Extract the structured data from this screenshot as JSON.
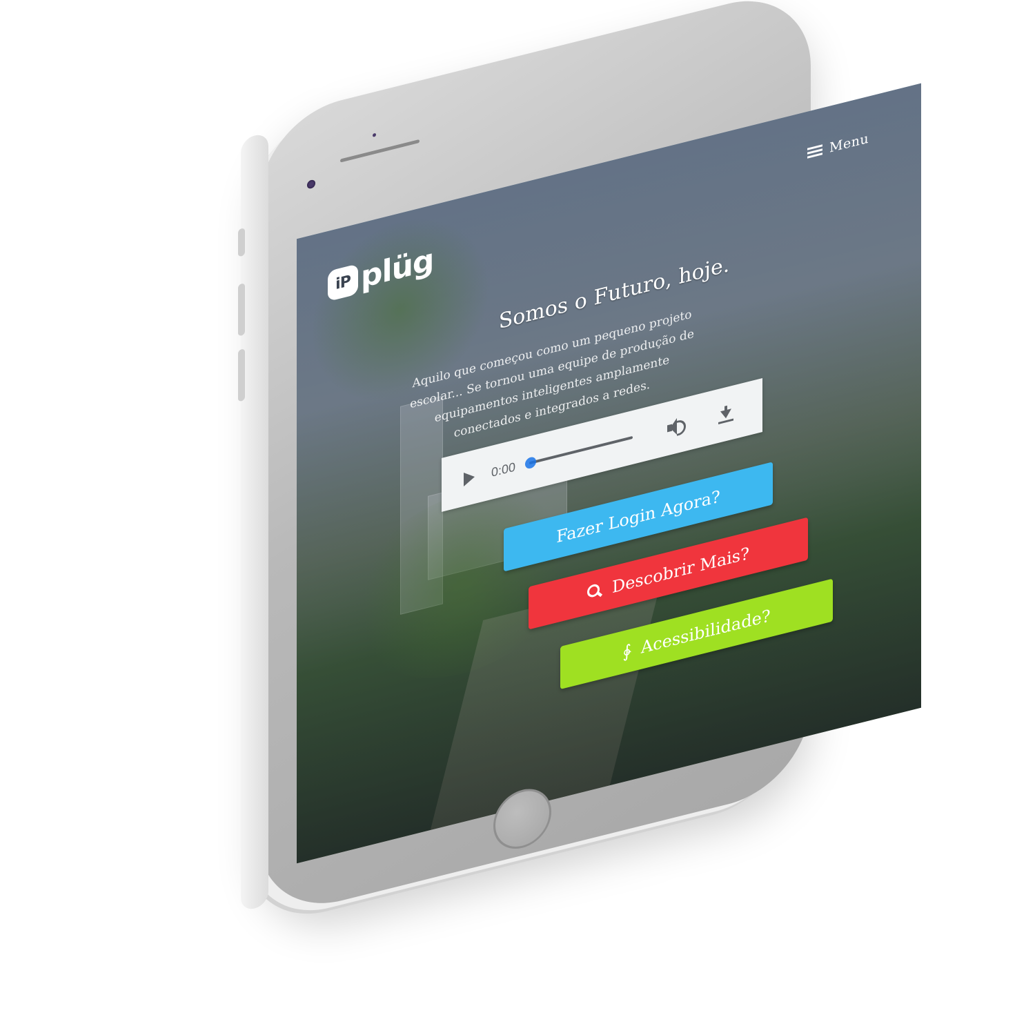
{
  "header": {
    "menu_label": "Menu",
    "menu_icon": "hamburger-icon",
    "logo": {
      "badge_text": "iP",
      "word": "plüg"
    }
  },
  "hero": {
    "title": "Somos o Futuro, hoje.",
    "description": "Aquilo que começou como um pequeno projeto escolar... Se tornou uma equipe de produção de equipamentos inteligentes amplamente conectados e integrados a redes."
  },
  "audio_player": {
    "current_time": "0:00",
    "progress": 0,
    "icons": [
      "play-icon",
      "volume-icon",
      "download-icon"
    ]
  },
  "buttons": {
    "login": {
      "label": "Fazer Login Agora?",
      "color": "#3db8f0"
    },
    "discover": {
      "label": "Descobrir Mais?",
      "color": "#f0353d",
      "icon": "search-icon"
    },
    "accessibility": {
      "label": "Acessibilidade?",
      "color": "#9fe022",
      "icon": "hearing-icon"
    }
  }
}
